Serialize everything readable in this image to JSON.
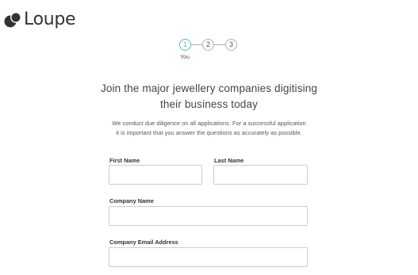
{
  "brand": {
    "name": "Loupe",
    "icon": "loupe-logo-icon",
    "accent_color": "#4fc1b3"
  },
  "stepper": {
    "steps": [
      {
        "label": "1",
        "active": true
      },
      {
        "label": "2",
        "active": false
      },
      {
        "label": "3",
        "active": false
      }
    ],
    "current_caption": "You"
  },
  "intro": {
    "headline_line1": "Join the major jewellery companies digitising",
    "headline_line2": "their business today",
    "description_line1": "We conduct due diligence on all applications. For a successful application",
    "description_line2": "it is important that you answer the questions as accurately as possible."
  },
  "form": {
    "first_name": {
      "label": "First Name",
      "value": ""
    },
    "last_name": {
      "label": "Last Name",
      "value": ""
    },
    "company_name": {
      "label": "Company Name",
      "value": ""
    },
    "company_email": {
      "label": "Company Email Address",
      "value": ""
    }
  }
}
